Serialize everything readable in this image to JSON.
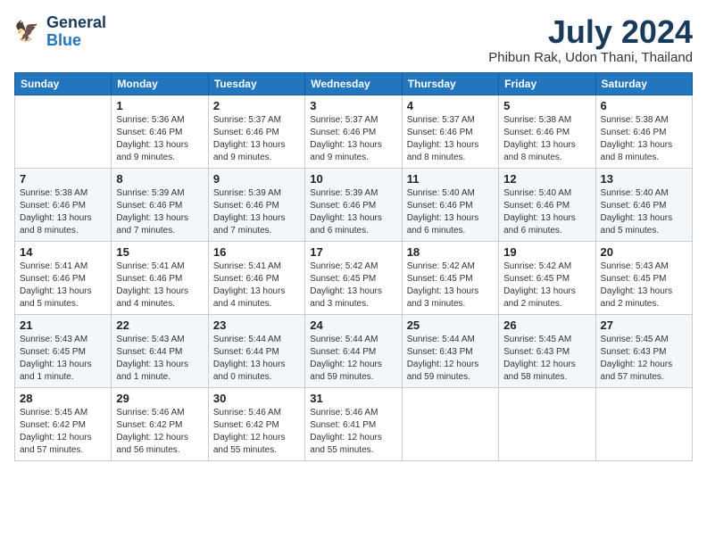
{
  "header": {
    "logo_line1": "General",
    "logo_line2": "Blue",
    "title": "July 2024",
    "location": "Phibun Rak, Udon Thani, Thailand"
  },
  "weekdays": [
    "Sunday",
    "Monday",
    "Tuesday",
    "Wednesday",
    "Thursday",
    "Friday",
    "Saturday"
  ],
  "weeks": [
    [
      {
        "day": "",
        "info": ""
      },
      {
        "day": "1",
        "info": "Sunrise: 5:36 AM\nSunset: 6:46 PM\nDaylight: 13 hours\nand 9 minutes."
      },
      {
        "day": "2",
        "info": "Sunrise: 5:37 AM\nSunset: 6:46 PM\nDaylight: 13 hours\nand 9 minutes."
      },
      {
        "day": "3",
        "info": "Sunrise: 5:37 AM\nSunset: 6:46 PM\nDaylight: 13 hours\nand 9 minutes."
      },
      {
        "day": "4",
        "info": "Sunrise: 5:37 AM\nSunset: 6:46 PM\nDaylight: 13 hours\nand 8 minutes."
      },
      {
        "day": "5",
        "info": "Sunrise: 5:38 AM\nSunset: 6:46 PM\nDaylight: 13 hours\nand 8 minutes."
      },
      {
        "day": "6",
        "info": "Sunrise: 5:38 AM\nSunset: 6:46 PM\nDaylight: 13 hours\nand 8 minutes."
      }
    ],
    [
      {
        "day": "7",
        "info": "Sunrise: 5:38 AM\nSunset: 6:46 PM\nDaylight: 13 hours\nand 8 minutes."
      },
      {
        "day": "8",
        "info": "Sunrise: 5:39 AM\nSunset: 6:46 PM\nDaylight: 13 hours\nand 7 minutes."
      },
      {
        "day": "9",
        "info": "Sunrise: 5:39 AM\nSunset: 6:46 PM\nDaylight: 13 hours\nand 7 minutes."
      },
      {
        "day": "10",
        "info": "Sunrise: 5:39 AM\nSunset: 6:46 PM\nDaylight: 13 hours\nand 6 minutes."
      },
      {
        "day": "11",
        "info": "Sunrise: 5:40 AM\nSunset: 6:46 PM\nDaylight: 13 hours\nand 6 minutes."
      },
      {
        "day": "12",
        "info": "Sunrise: 5:40 AM\nSunset: 6:46 PM\nDaylight: 13 hours\nand 6 minutes."
      },
      {
        "day": "13",
        "info": "Sunrise: 5:40 AM\nSunset: 6:46 PM\nDaylight: 13 hours\nand 5 minutes."
      }
    ],
    [
      {
        "day": "14",
        "info": "Sunrise: 5:41 AM\nSunset: 6:46 PM\nDaylight: 13 hours\nand 5 minutes."
      },
      {
        "day": "15",
        "info": "Sunrise: 5:41 AM\nSunset: 6:46 PM\nDaylight: 13 hours\nand 4 minutes."
      },
      {
        "day": "16",
        "info": "Sunrise: 5:41 AM\nSunset: 6:46 PM\nDaylight: 13 hours\nand 4 minutes."
      },
      {
        "day": "17",
        "info": "Sunrise: 5:42 AM\nSunset: 6:45 PM\nDaylight: 13 hours\nand 3 minutes."
      },
      {
        "day": "18",
        "info": "Sunrise: 5:42 AM\nSunset: 6:45 PM\nDaylight: 13 hours\nand 3 minutes."
      },
      {
        "day": "19",
        "info": "Sunrise: 5:42 AM\nSunset: 6:45 PM\nDaylight: 13 hours\nand 2 minutes."
      },
      {
        "day": "20",
        "info": "Sunrise: 5:43 AM\nSunset: 6:45 PM\nDaylight: 13 hours\nand 2 minutes."
      }
    ],
    [
      {
        "day": "21",
        "info": "Sunrise: 5:43 AM\nSunset: 6:45 PM\nDaylight: 13 hours\nand 1 minute."
      },
      {
        "day": "22",
        "info": "Sunrise: 5:43 AM\nSunset: 6:44 PM\nDaylight: 13 hours\nand 1 minute."
      },
      {
        "day": "23",
        "info": "Sunrise: 5:44 AM\nSunset: 6:44 PM\nDaylight: 13 hours\nand 0 minutes."
      },
      {
        "day": "24",
        "info": "Sunrise: 5:44 AM\nSunset: 6:44 PM\nDaylight: 12 hours\nand 59 minutes."
      },
      {
        "day": "25",
        "info": "Sunrise: 5:44 AM\nSunset: 6:43 PM\nDaylight: 12 hours\nand 59 minutes."
      },
      {
        "day": "26",
        "info": "Sunrise: 5:45 AM\nSunset: 6:43 PM\nDaylight: 12 hours\nand 58 minutes."
      },
      {
        "day": "27",
        "info": "Sunrise: 5:45 AM\nSunset: 6:43 PM\nDaylight: 12 hours\nand 57 minutes."
      }
    ],
    [
      {
        "day": "28",
        "info": "Sunrise: 5:45 AM\nSunset: 6:42 PM\nDaylight: 12 hours\nand 57 minutes."
      },
      {
        "day": "29",
        "info": "Sunrise: 5:46 AM\nSunset: 6:42 PM\nDaylight: 12 hours\nand 56 minutes."
      },
      {
        "day": "30",
        "info": "Sunrise: 5:46 AM\nSunset: 6:42 PM\nDaylight: 12 hours\nand 55 minutes."
      },
      {
        "day": "31",
        "info": "Sunrise: 5:46 AM\nSunset: 6:41 PM\nDaylight: 12 hours\nand 55 minutes."
      },
      {
        "day": "",
        "info": ""
      },
      {
        "day": "",
        "info": ""
      },
      {
        "day": "",
        "info": ""
      }
    ]
  ]
}
